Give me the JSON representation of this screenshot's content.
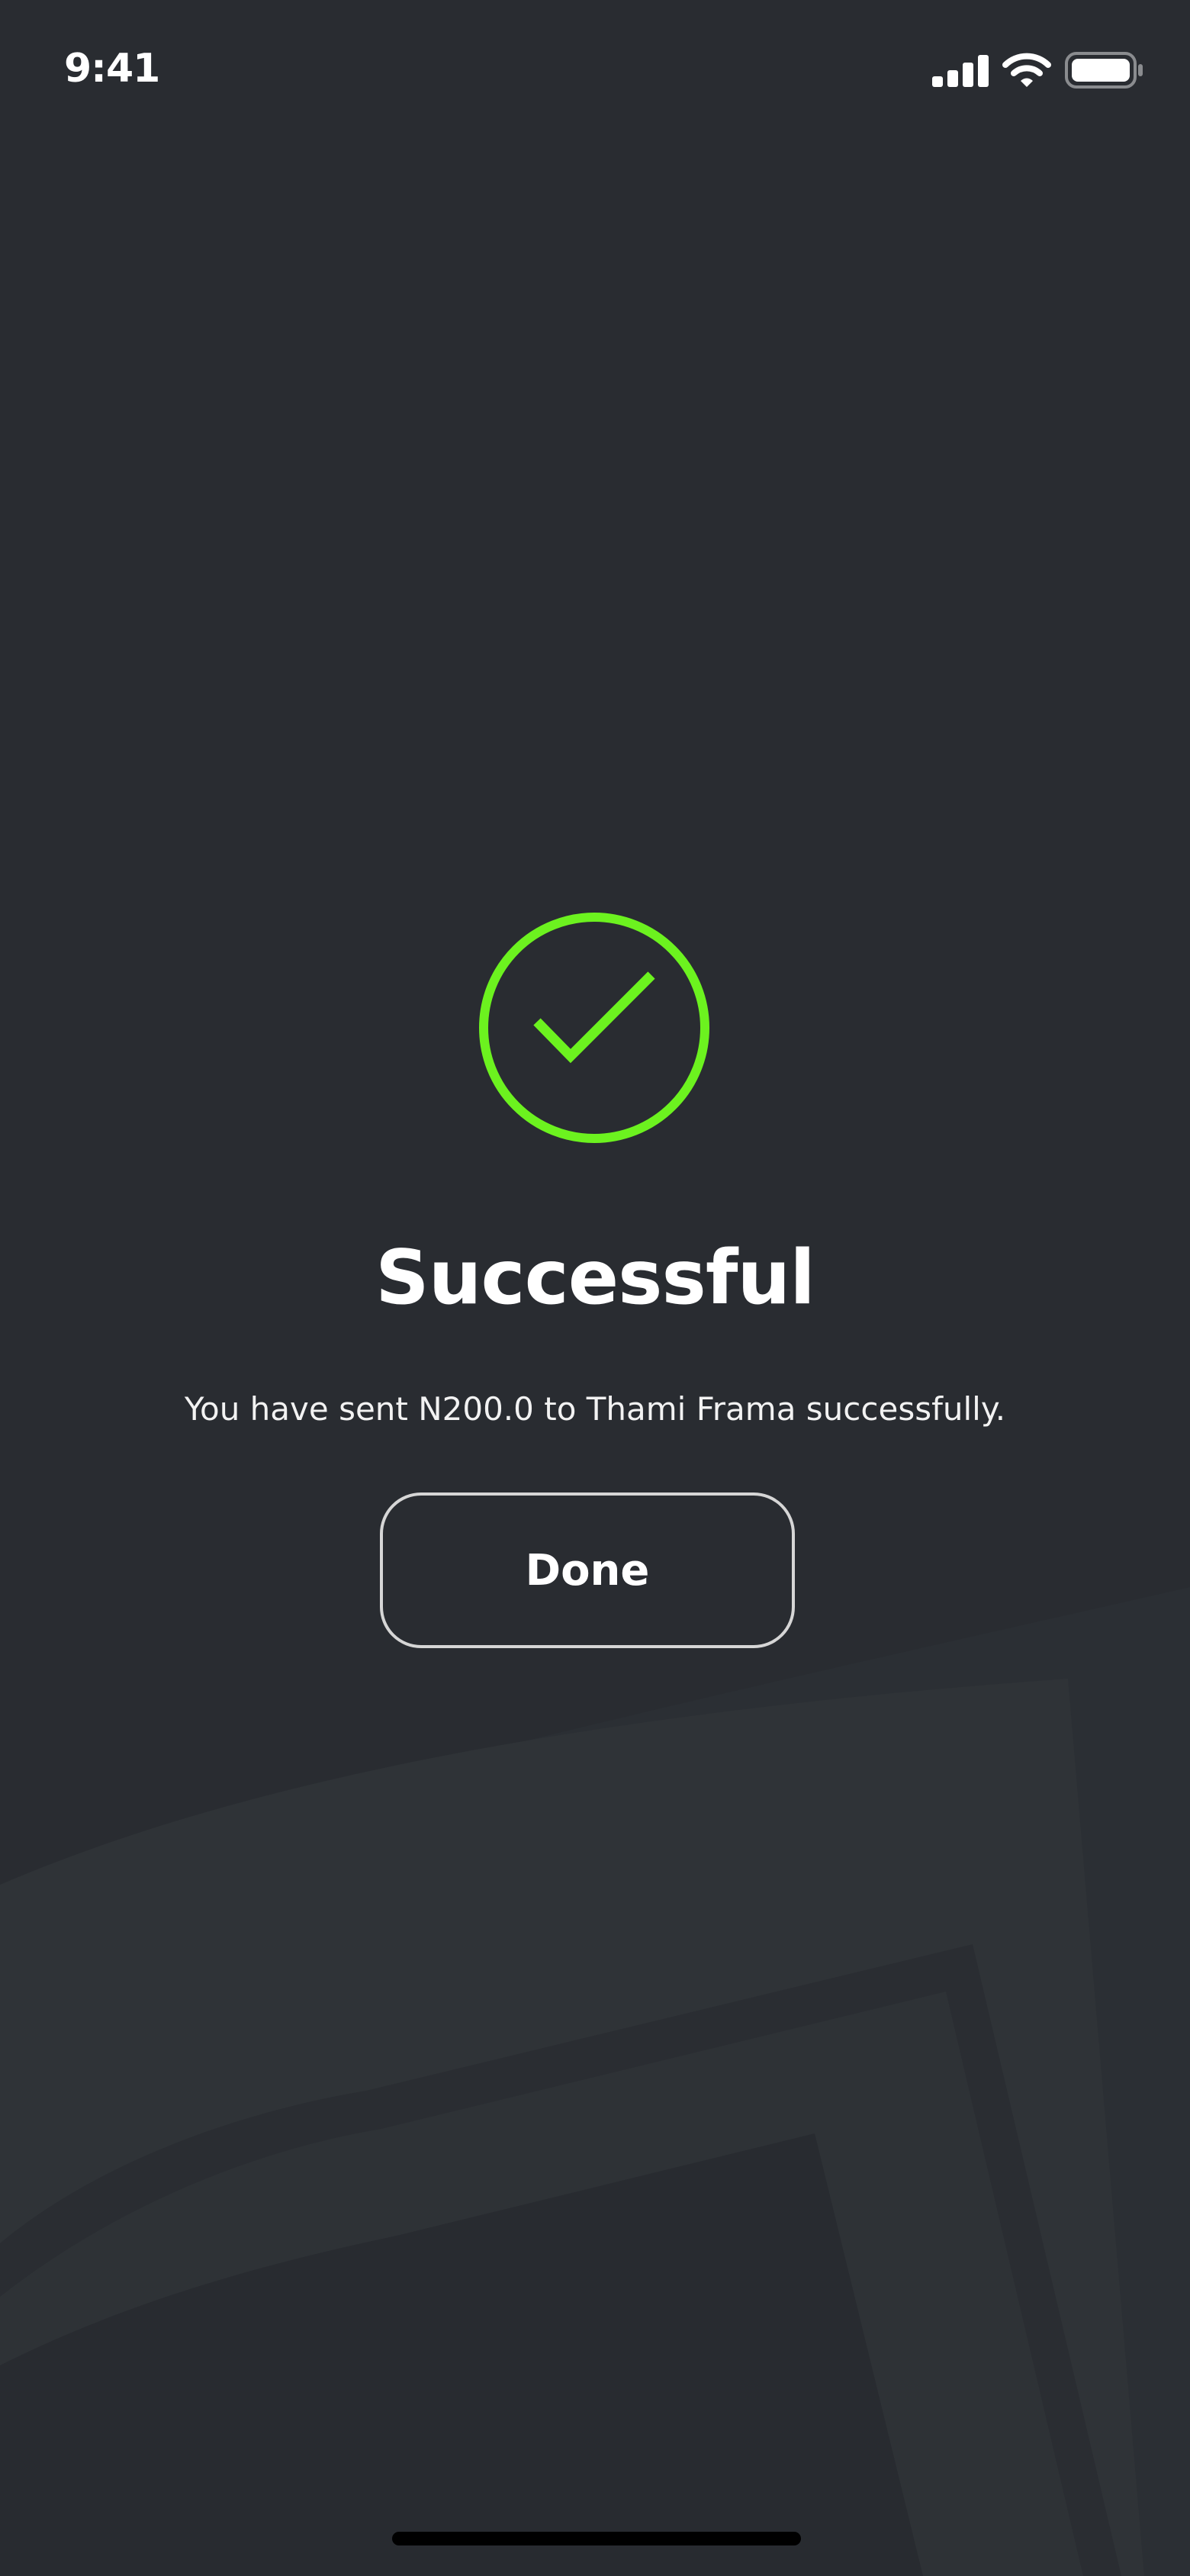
{
  "status_bar": {
    "time": "9:41",
    "icons": [
      "cellular-signal-icon",
      "wifi-icon",
      "battery-icon"
    ]
  },
  "success": {
    "icon": "checkmark-circle-icon",
    "title": "Successful",
    "message": "You have sent N200.0 to Thami Frama successfully.",
    "done_label": "Done"
  },
  "colors": {
    "background": "#292c31",
    "accent": "#6cf21f",
    "button_border": "#d6d6d6",
    "text": "#ffffff"
  }
}
